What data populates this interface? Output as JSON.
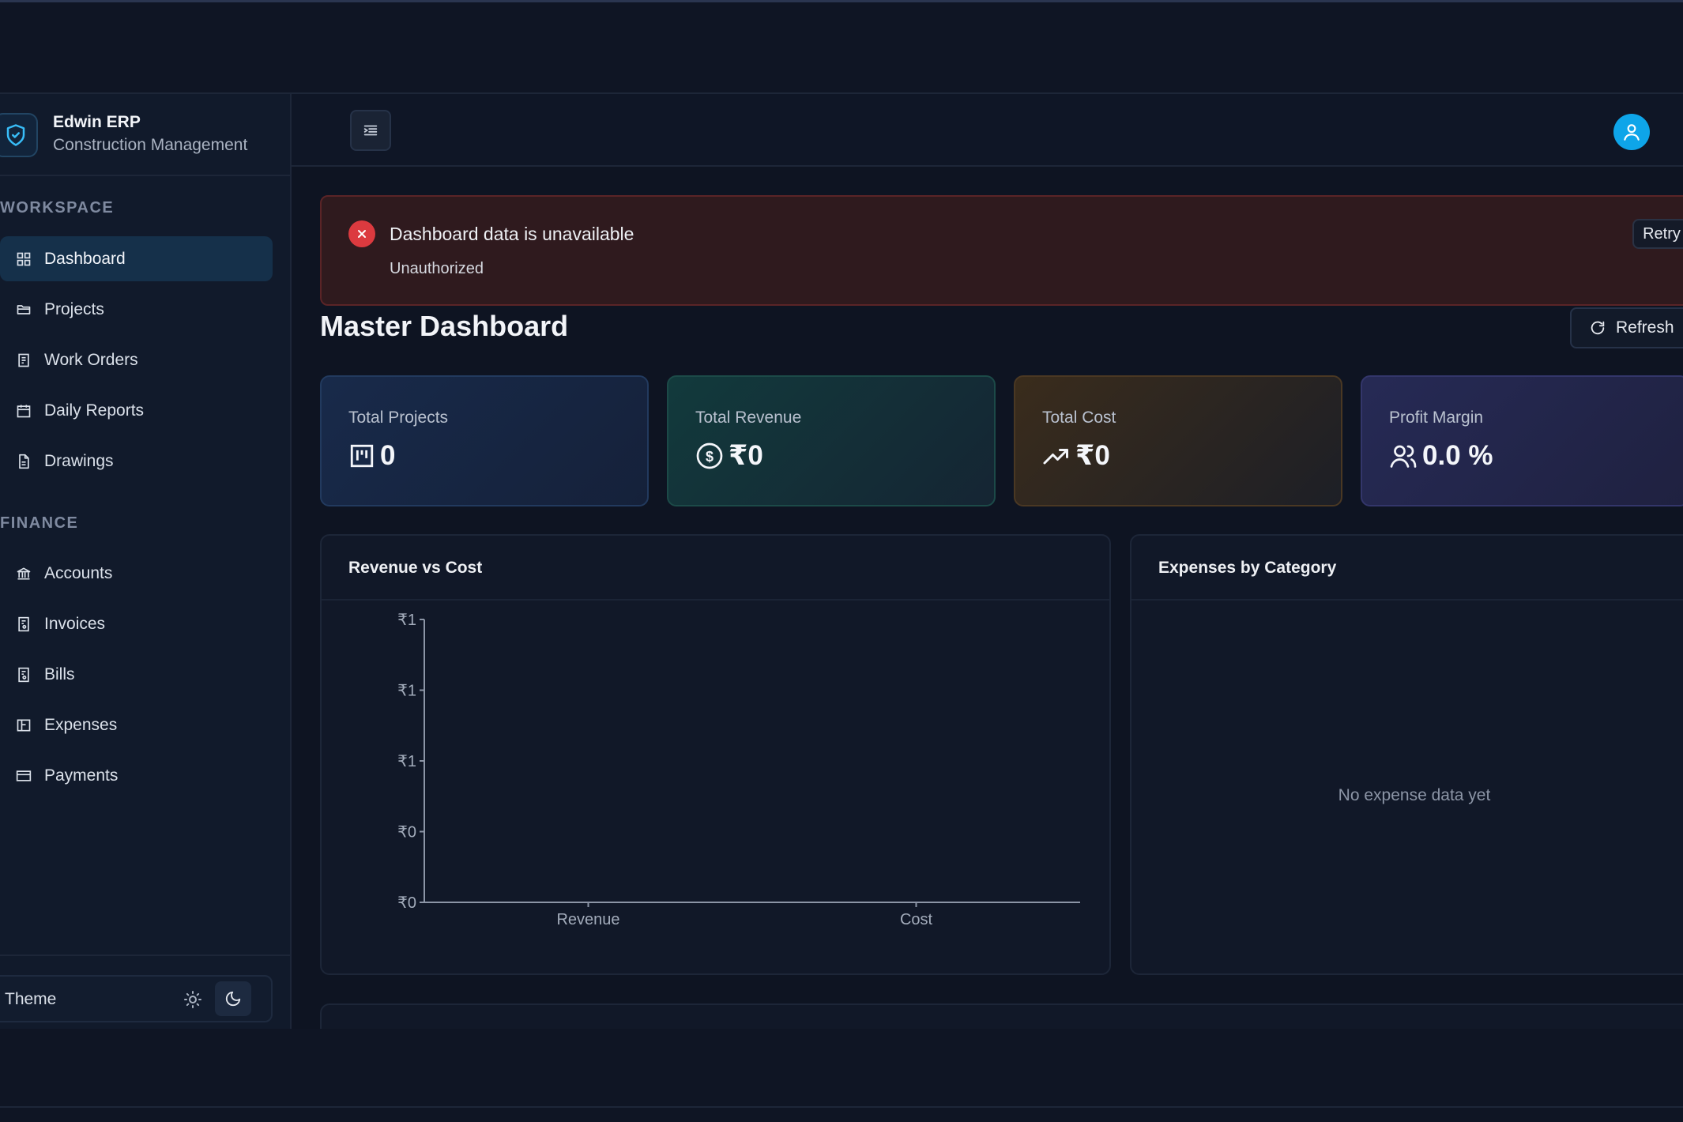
{
  "app": {
    "brand_title": "Edwin ERP",
    "brand_subtitle": "Construction Management"
  },
  "sidebar": {
    "sections": [
      {
        "label": "WORKSPACE",
        "items": [
          {
            "label": "Dashboard",
            "icon": "grid-icon",
            "active": true
          },
          {
            "label": "Projects",
            "icon": "folder-icon"
          },
          {
            "label": "Work Orders",
            "icon": "clipboard-icon"
          },
          {
            "label": "Daily Reports",
            "icon": "calendar-icon"
          },
          {
            "label": "Drawings",
            "icon": "file-icon"
          }
        ]
      },
      {
        "label": "FINANCE",
        "items": [
          {
            "label": "Accounts",
            "icon": "bank-icon"
          },
          {
            "label": "Invoices",
            "icon": "receipt-icon"
          },
          {
            "label": "Bills",
            "icon": "receipt-icon"
          },
          {
            "label": "Expenses",
            "icon": "wallet-icon"
          },
          {
            "label": "Payments",
            "icon": "card-icon"
          }
        ]
      }
    ],
    "theme": {
      "label": "Theme",
      "mode": "dark"
    }
  },
  "alert": {
    "title": "Dashboard data is unavailable",
    "message": "Unauthorized",
    "retry_label": "Retry"
  },
  "page": {
    "title": "Master Dashboard",
    "refresh_label": "Refresh"
  },
  "stats": [
    {
      "label": "Total Projects",
      "value": "0",
      "icon": "kanban-icon"
    },
    {
      "label": "Total Revenue",
      "value": "₹0",
      "icon": "dollar-circle-icon"
    },
    {
      "label": "Total Cost",
      "value": "₹0",
      "icon": "trending-up-icon"
    },
    {
      "label": "Profit Margin",
      "value": "0.0 %",
      "icon": "users-icon"
    }
  ],
  "panels": {
    "revenue_vs_cost": {
      "title": "Revenue vs Cost"
    },
    "expenses": {
      "title": "Expenses by Category",
      "empty_text": "No expense data yet"
    }
  },
  "chart_data": {
    "type": "bar",
    "title": "Revenue vs Cost",
    "categories": [
      "Revenue",
      "Cost"
    ],
    "values": [
      0,
      0
    ],
    "y_tick_labels": [
      "₹0",
      "₹0",
      "₹1",
      "₹1",
      "₹1"
    ],
    "ylim": [
      0,
      1
    ],
    "grid": false
  },
  "colors": {
    "accent": "#0ea5e9",
    "error": "#dc3a3f",
    "background": "#0e1422"
  }
}
